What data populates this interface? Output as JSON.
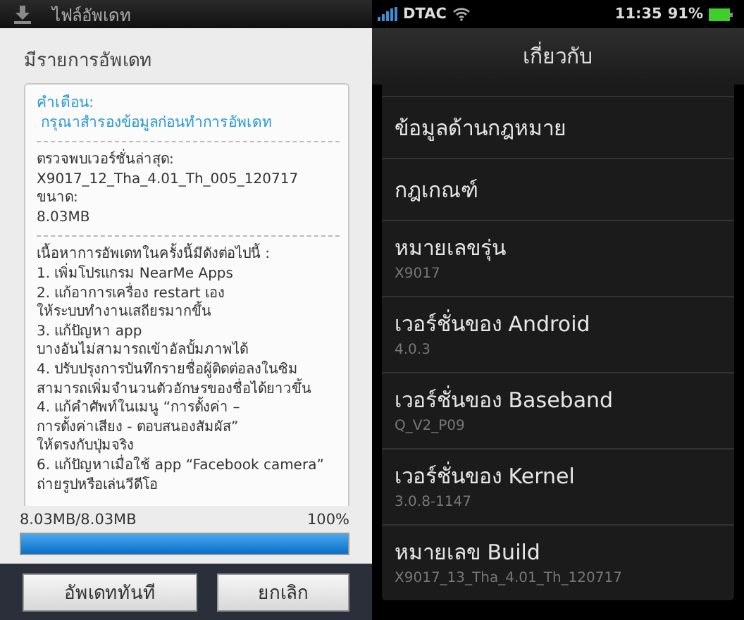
{
  "left": {
    "title": "ไฟล์อัพเดท",
    "heading": "มีรายการอัพเดท",
    "warning": {
      "label": "คำเตือน:",
      "text": "กรุณาสำรองข้อมูลก่อนทำการอัพเดท"
    },
    "version_lines": [
      "ตรวจพบเวอร์ชั่นล่าสุด:",
      "X9017_12_Tha_4.01_Th_005_120717",
      "ขนาด:",
      "8.03MB"
    ],
    "content_lines": [
      "เนื้อหาการอัพเดทในครั้งนี้มีดังต่อไปนี้ :",
      "1. เพิ่มโปรแกรม NearMe Apps",
      "2. แก้อาการเครื่อง restart เอง",
      "ให้ระบบทำงานเสถียรมากขึ้น",
      "3. แก้ปัญหา app",
      "บางอันไม่สามารถเข้าอัลบั้มภาพได้",
      "4. ปรับปรุงการบันทึกรายชื่อผู้ติดต่อลงในซิม",
      "สามารถเพิ่มจำนวนตัวอักษรของชื่อได้ยาวขึ้น",
      "4. แก้คำศัพท์ในเมนู “การตั้งค่า –",
      "การตั้งค่าเสียง - ตอบสนองสัมผัส”",
      "ให้ตรงกับปุ่มจริง",
      "6. แก้ปัญหาเมื่อใช้ app “Facebook camera”",
      "ถ่ายรูปหรือเล่นวีดีโอ"
    ],
    "progress": {
      "size": "8.03MB/8.03MB",
      "percent": "100%",
      "level": 1.0
    },
    "buttons": [
      "อัพเดททันที",
      "ยกเลิก"
    ]
  },
  "right": {
    "status_bar": {
      "carrier": "DTAC",
      "time": "11:35",
      "battery": "91%"
    },
    "title": "เกี่ยวกับ",
    "items": [
      {
        "title": "ข้อมูลด้านกฎหมาย"
      },
      {
        "title": "กฎเกณฑ์"
      },
      {
        "title": "หมายเลขรุ่น",
        "value": "X9017"
      },
      {
        "title": "เวอร์ชั่นของ Android",
        "value": "4.0.3"
      },
      {
        "title": "เวอร์ชั่นของ Baseband",
        "value": "Q_V2_P09"
      },
      {
        "title": "เวอร์ชั่นของ Kernel",
        "value": "3.0.8-1147"
      },
      {
        "title": "หมายเลข Build",
        "value": "X9017_13_Tha_4.01_Th_120717"
      }
    ]
  }
}
